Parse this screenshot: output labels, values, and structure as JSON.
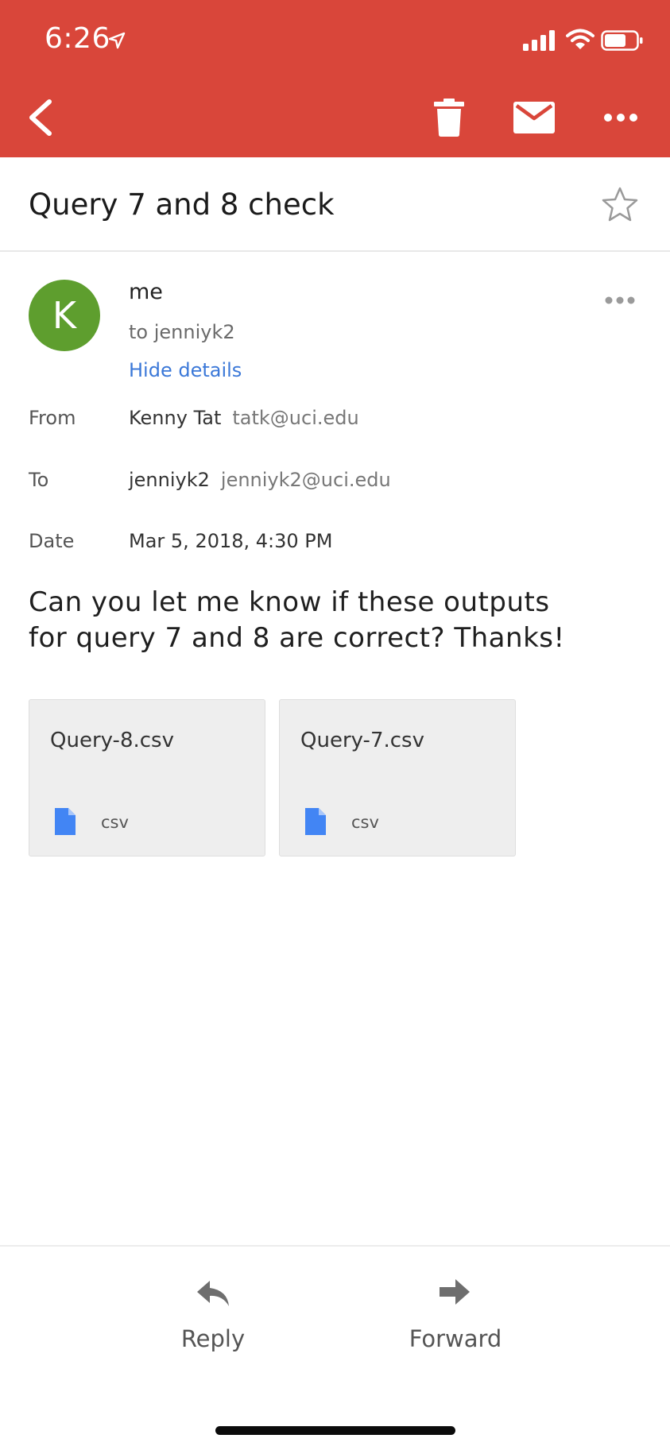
{
  "status_bar": {
    "time": "6:26"
  },
  "toolbar": {
    "back_icon": "chevron-left-icon",
    "delete_icon": "trash-icon",
    "mark_unread_icon": "envelope-icon",
    "more_icon": "more-horizontal-icon"
  },
  "email": {
    "subject": "Query 7 and 8 check",
    "avatar_letter": "K",
    "sender_name": "me",
    "to_summary": "to jenniyk2",
    "hide_details": "Hide details",
    "details": {
      "from_label": "From",
      "from_name": "Kenny Tat",
      "from_email": "tatk@uci.edu",
      "to_label": "To",
      "to_name": "jenniyk2",
      "to_email": "jenniyk2@uci.edu",
      "date_label": "Date",
      "date_value": "Mar 5, 2018, 4:30 PM"
    },
    "body": "Can you let me know if these outputs for query 7 and 8 are correct? Thanks!",
    "attachments": [
      {
        "name": "Query-8.csv",
        "type": "csv"
      },
      {
        "name": "Query-7.csv",
        "type": "csv"
      }
    ]
  },
  "actions": {
    "reply_label": "Reply",
    "forward_label": "Forward"
  },
  "colors": {
    "header": "#d9463a",
    "avatar": "#5e9e2e",
    "link": "#3b78d8",
    "file_icon": "#4285f4"
  }
}
